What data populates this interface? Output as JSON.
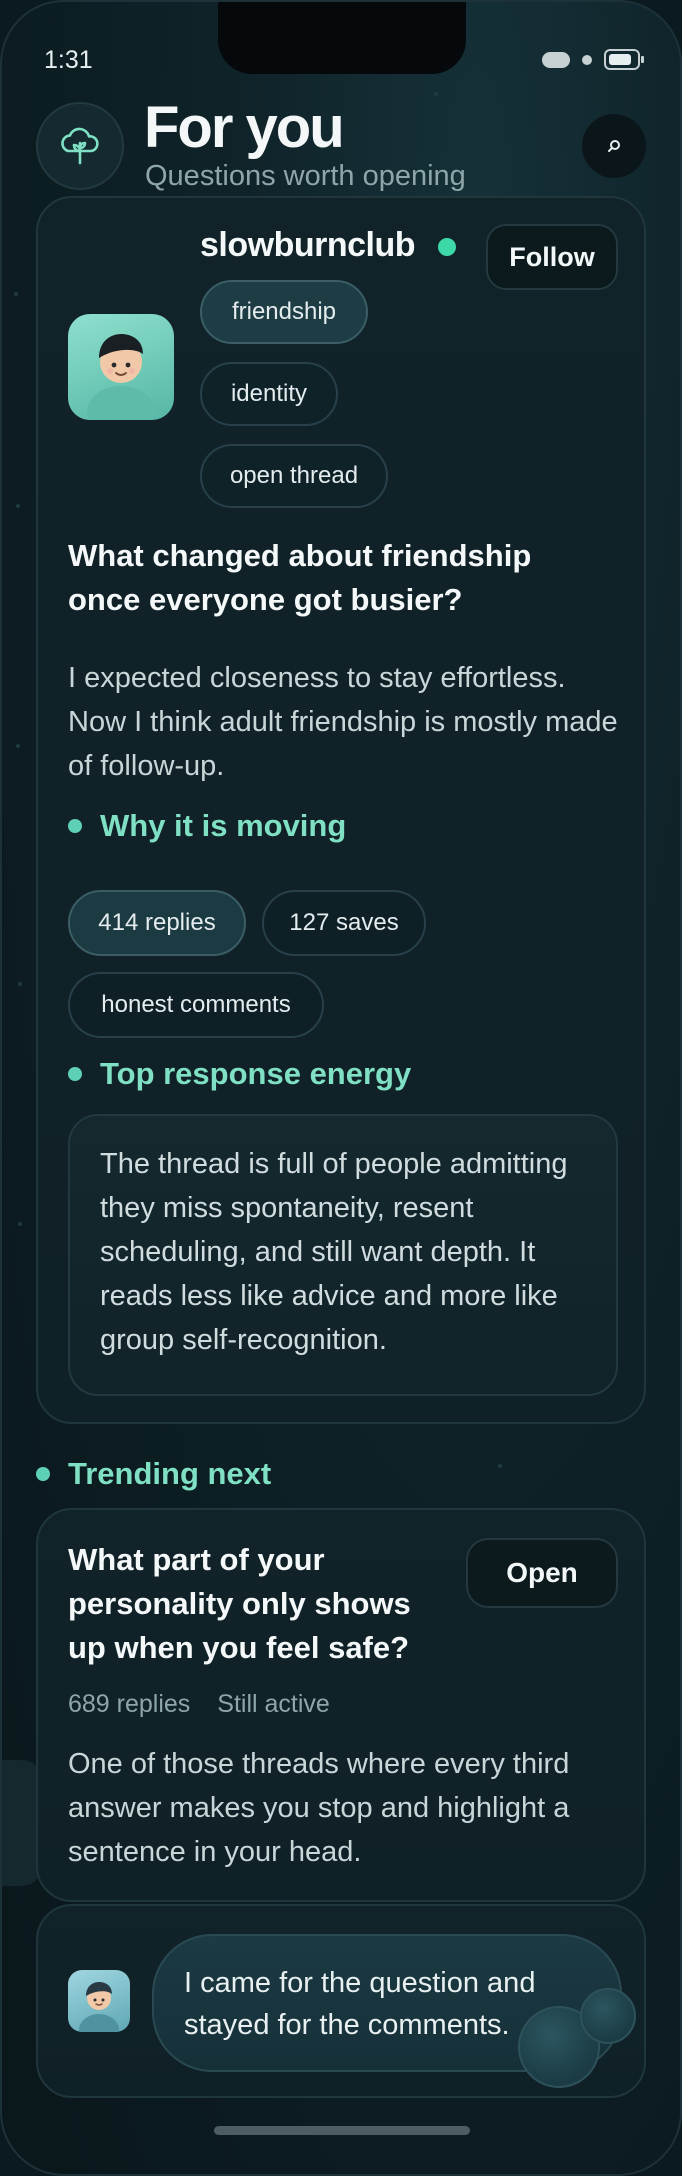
{
  "status_bar": {
    "time": "1:31"
  },
  "header": {
    "title": "For you",
    "subtitle": "Questions worth opening",
    "logo_icon": "sprout-cloud-icon",
    "search_icon": "search-icon"
  },
  "post": {
    "username": "slowburnclub",
    "follow_label": "Follow",
    "tags": [
      "friendship",
      "identity",
      "open thread"
    ],
    "question": "What changed about friendship once everyone got busier?",
    "body": "I expected closeness to stay effortless. Now I think adult friendship is mostly made of follow-up.",
    "why_moving": {
      "heading": "Why it is moving",
      "chips": [
        "414 replies",
        "127 saves",
        "honest comments"
      ]
    },
    "top_response": {
      "heading": "Top response energy",
      "text": "The thread is full of people admitting they miss spontaneity, resent scheduling, and still want depth. It reads less like advice and more like group self-recognition."
    }
  },
  "trending": {
    "heading": "Trending next",
    "question": "What part of your personality only shows up when you feel safe?",
    "open_label": "Open",
    "replies": "689 replies",
    "status": "Still active",
    "body": "One of those threads where every third answer makes you stop and highlight a sentence in your head."
  },
  "comment": {
    "text": "I came for the question and stayed for the comments."
  },
  "colors": {
    "accent": "#7fe0c4",
    "online": "#3dd8a8",
    "background": "#0c1c21"
  }
}
